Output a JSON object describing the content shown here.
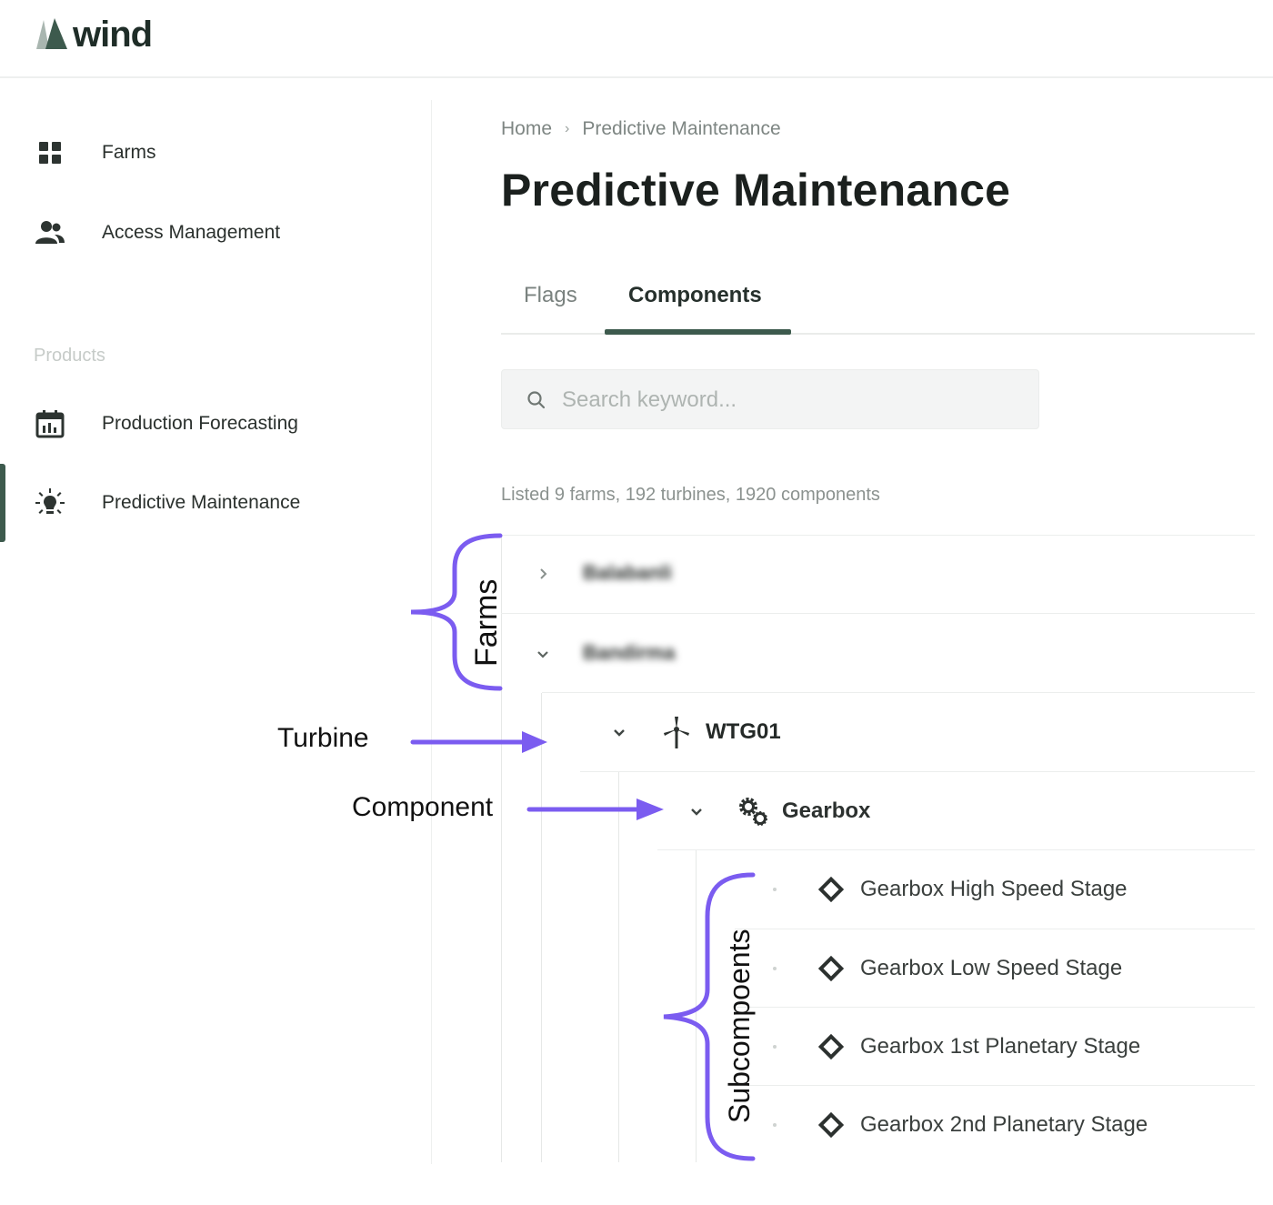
{
  "header": {
    "logo_text": "wind",
    "logo_color": "#3d5a4d"
  },
  "sidebar": {
    "items": [
      {
        "label": "Farms",
        "icon": "grid-icon"
      },
      {
        "label": "Access Management",
        "icon": "users-icon"
      }
    ],
    "section_label": "Products",
    "products": [
      {
        "label": "Production Forecasting",
        "icon": "calendar-chart-icon"
      },
      {
        "label": "Predictive Maintenance",
        "icon": "lightbulb-icon",
        "active": true
      }
    ]
  },
  "main": {
    "breadcrumb": [
      "Home",
      "Predictive Maintenance"
    ],
    "title": "Predictive Maintenance",
    "tabs": [
      {
        "label": "Flags",
        "active": false
      },
      {
        "label": "Components",
        "active": true
      }
    ],
    "search": {
      "placeholder": "Search keyword..."
    },
    "summary": "Listed 9 farms, 192 turbines, 1920 components",
    "tree": {
      "farms": [
        {
          "name": "Balabanli",
          "expanded": false
        },
        {
          "name": "Bandirma",
          "expanded": true
        }
      ],
      "turbine": {
        "name": "WTG01",
        "icon": "wind-turbine-icon"
      },
      "component": {
        "name": "Gearbox",
        "icon": "gears-icon"
      },
      "subcomponents": [
        {
          "name": "Gearbox High Speed Stage",
          "icon": "diamond-icon"
        },
        {
          "name": "Gearbox Low Speed Stage",
          "icon": "diamond-icon"
        },
        {
          "name": "Gearbox 1st Planetary Stage",
          "icon": "diamond-icon"
        },
        {
          "name": "Gearbox 2nd Planetary Stage",
          "icon": "diamond-icon"
        }
      ]
    }
  },
  "annotations": {
    "farms": "Farms",
    "turbine": "Turbine",
    "component": "Component",
    "subcomponents": "Subcompoents",
    "color": "#7b5cf0"
  },
  "colors": {
    "accent": "#3d5a4d",
    "annotation": "#7b5cf0"
  }
}
